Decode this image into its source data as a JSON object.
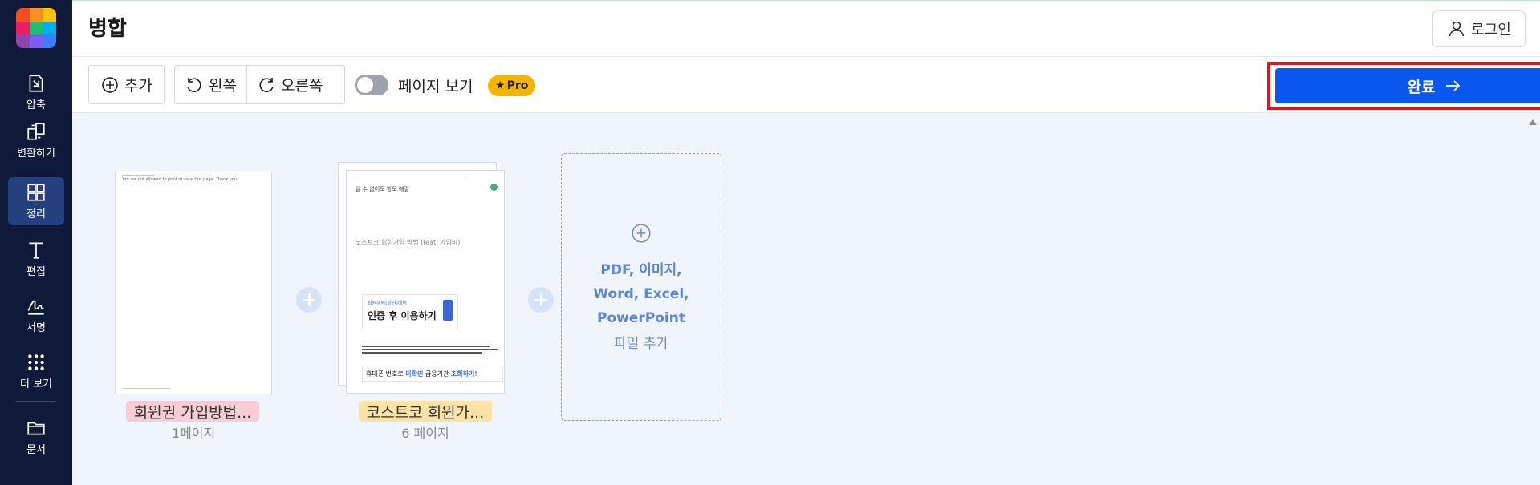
{
  "app": {
    "title": "병합",
    "login_label": "로그인"
  },
  "sidebar": {
    "items": [
      {
        "label": "압축",
        "icon": "compress-icon"
      },
      {
        "label": "변환하기",
        "icon": "convert-icon"
      },
      {
        "label": "정리",
        "icon": "organize-icon",
        "active": true
      },
      {
        "label": "편집",
        "icon": "text-edit-icon"
      },
      {
        "label": "서명",
        "icon": "signature-icon"
      },
      {
        "label": "더 보기",
        "icon": "more-grid-icon"
      },
      {
        "label": "문서",
        "icon": "folder-icon"
      }
    ]
  },
  "toolbar": {
    "add_label": "추가",
    "rotate_left_label": "왼쪽",
    "rotate_right_label": "오른쪽",
    "page_view_label": "페이지 보기",
    "pro_label": "Pro",
    "done_label": "완료",
    "page_view_enabled": false
  },
  "files": [
    {
      "name": "회원권 가입방법...",
      "pages_count": "1",
      "pages_suffix": "페이지",
      "tag_color": "#f9cdd6"
    },
    {
      "name": "코스트코 회원가...",
      "pages_count": "6",
      "pages_suffix": "페이지",
      "tag_color": "#fbe3a6"
    }
  ],
  "doc1": {
    "line1": "You are not allowed to print or save this page. Thank you."
  },
  "doc2": {
    "heading": "알 수 없어도 방도 해결",
    "subtitle": "코스트코 회원가입 방법 (feat. 가입비)",
    "box_small": "회원혜택(할인)혜택",
    "box_title": "인증 후 이용하기",
    "footer_prefix": "휴대폰 번호로 ",
    "footer_highlight1": "미확인",
    "footer_mid": " 금융기관 ",
    "footer_highlight2": "조회하기",
    "footer_suffix": "!"
  },
  "add_zone": {
    "types_line1": "PDF, 이미지,",
    "types_line2": "Word, Excel,",
    "types_line3": "PowerPoint",
    "sub": "파일 추가"
  },
  "colors": {
    "sidebar_bg": "#0f1a3a",
    "accent": "#0a57f0",
    "highlight_border": "#e0141a",
    "pro_badge": "#f4b400",
    "workarea_bg": "#f0f4fb"
  }
}
